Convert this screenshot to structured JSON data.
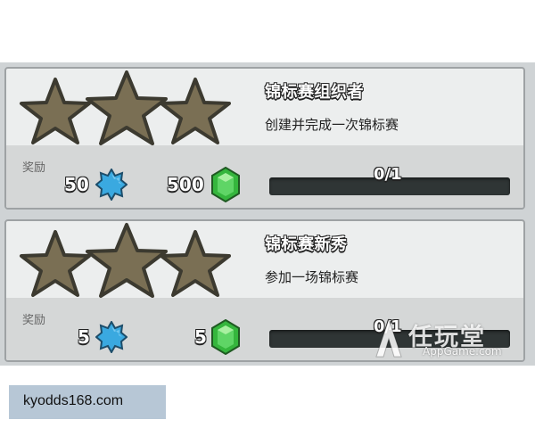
{
  "colors": {
    "star": "#7a6f54",
    "star_outline": "#54503f",
    "progress_track": "#2f3535",
    "xp_icon": "#3aa9e0",
    "gem": "#35b63d"
  },
  "achievements": [
    {
      "title": "锦标赛组织者",
      "description": "创建并完成一次锦标赛",
      "reward_label": "奖励",
      "xp": "50",
      "gems": "500",
      "progress_text": "0/1",
      "progress_fraction": 0
    },
    {
      "title": "锦标赛新秀",
      "description": "参加一场锦标赛",
      "reward_label": "奖励",
      "xp": "5",
      "gems": "5",
      "progress_text": "0/1",
      "progress_fraction": 0
    }
  ],
  "watermark": {
    "name": "任玩堂",
    "site": "AppGame.com"
  },
  "footer": {
    "site": "kyodds168.com"
  },
  "icons": {
    "stars": "star-icon",
    "xp": "xp-star-icon",
    "gem": "gem-icon"
  }
}
